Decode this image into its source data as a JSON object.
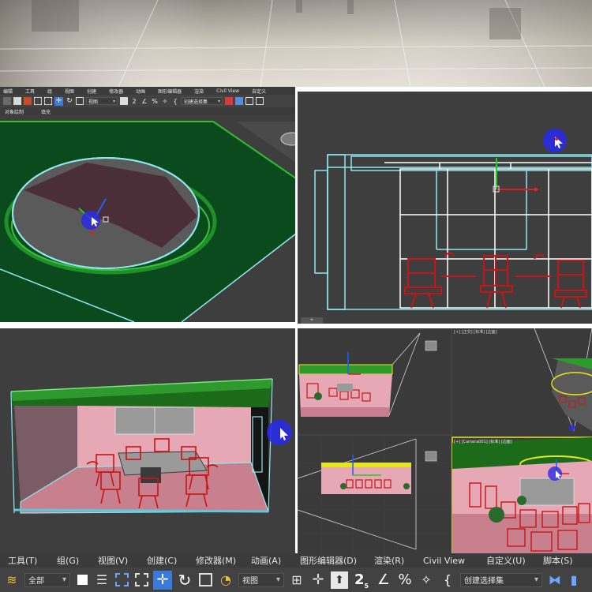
{
  "colors": {
    "ui_dark": "#3b3b3b",
    "viewport_bg": "#3e3e3e",
    "viewport_bg_dark": "#363636",
    "green_surface": "#0a4a1c",
    "green_bright": "#26a626",
    "cyan_selection": "#8ee8f0",
    "pink_walls": "#e6a8b4",
    "red_furniture": "#c81414",
    "yellow_highlight": "#e6e61e",
    "cursor_blue": "#2a2ae6"
  },
  "top_menu": {
    "items": [
      "编辑",
      "工具",
      "组",
      "视图",
      "创建",
      "修改器",
      "动画",
      "图形编辑器",
      "渲染",
      "Civil View",
      "自定义",
      "脚本"
    ],
    "sub_tabs": [
      "对象绘制",
      "填充"
    ],
    "selection_dropdown": "视图",
    "named_set": "创建选择集"
  },
  "viewport_front": {
    "corner": "+"
  },
  "viewport_quad_right": {
    "top_label": "[+] [正交] [标准] [边面]",
    "bottom_label": "[+] [Camera001] [标准] [边面]"
  },
  "bottom_menu": {
    "items": [
      {
        "label": "工具(T)"
      },
      {
        "label": "组(G)"
      },
      {
        "label": "视图(V)"
      },
      {
        "label": "创建(C)"
      },
      {
        "label": "修改器(M)"
      },
      {
        "label": "动画(A)"
      },
      {
        "label": "图形编辑器(D)"
      },
      {
        "label": "渲染(R)"
      },
      {
        "label": "Civil View"
      },
      {
        "label": "自定义(U)"
      },
      {
        "label": "脚本(S)"
      }
    ]
  },
  "bottom_toolbar": {
    "filter_dropdown": "全部",
    "coord_dropdown": "视图",
    "snap_label": "2",
    "snap_sub": "5",
    "named_selection": "创建选择集"
  },
  "icons": [
    "undo-icon",
    "select-icon",
    "select-by-name-icon",
    "rect-select-icon",
    "window-crossing-icon",
    "move-icon",
    "rotate-icon",
    "scale-icon",
    "place-icon",
    "pivot-icon",
    "snap-icon",
    "angle-snap-icon",
    "percent-snap-icon",
    "spinner-snap-icon",
    "named-sel-icon",
    "mirror-icon",
    "align-icon"
  ]
}
